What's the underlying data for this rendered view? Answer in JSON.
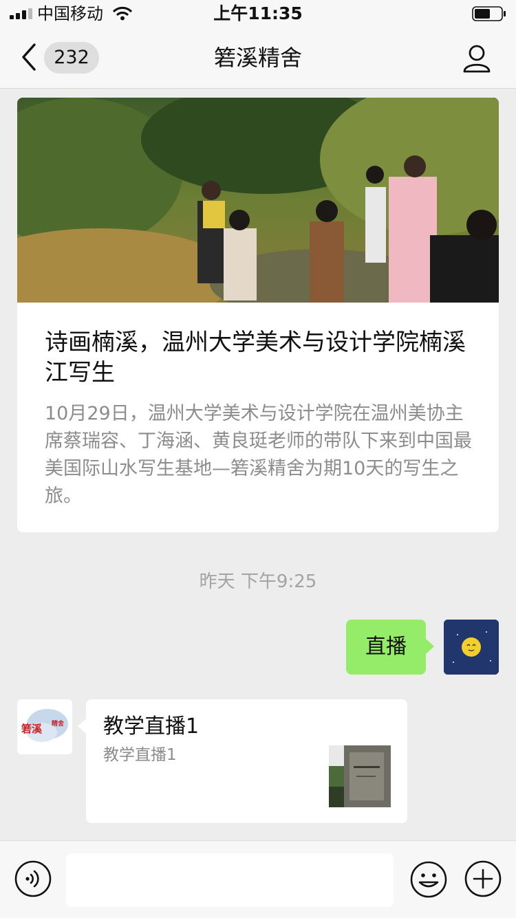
{
  "status_bar": {
    "carrier": "中国移动",
    "time": "上午11:35"
  },
  "nav": {
    "unread_count": "232",
    "title": "箬溪精舍"
  },
  "article": {
    "title": "诗画楠溪，温州大学美术与设计学院楠溪江写生",
    "summary": "10月29日，温州大学美术与设计学院在温州美协主席蔡瑞容、丁海涵、黄良珽老师的带队下来到中国最美国际山水写生基地—箬溪精舍为期10天的写生之旅。"
  },
  "timestamp": "昨天 下午9:25",
  "outgoing_message": {
    "text": "直播"
  },
  "incoming_card": {
    "title": "教学直播1",
    "description": "教学直播1",
    "avatar_logo_text": "箬溪精舍"
  },
  "input": {
    "placeholder": ""
  },
  "colors": {
    "outgoing_bubble": "#95ec69",
    "background": "#ededed",
    "bar_background": "#f7f7f7"
  },
  "icons": {
    "back": "chevron-left-icon",
    "profile": "person-icon",
    "voice": "voice-icon",
    "emoji": "smiley-icon",
    "plus": "plus-icon"
  }
}
